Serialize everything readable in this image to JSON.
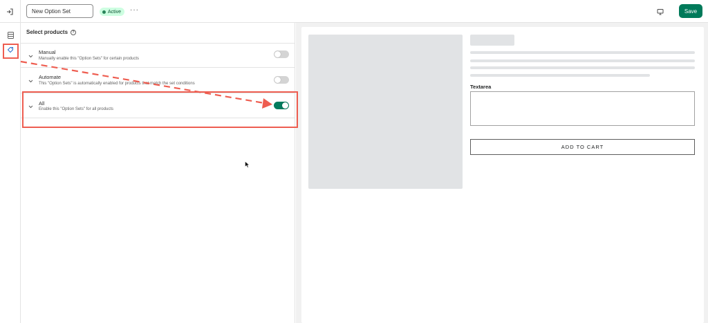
{
  "topbar": {
    "name_value": "New Option Set",
    "status": "Active",
    "more_label": "···",
    "save_label": "Save"
  },
  "panel": {
    "title": "Select products",
    "options": [
      {
        "title": "Manual",
        "description": "Manually enable this \"Option Sets\" for certain products",
        "enabled": false
      },
      {
        "title": "Automate",
        "description": "This \"Option Sets\" is automatically enabled for products that match the set conditions",
        "enabled": false
      },
      {
        "title": "All",
        "description": "Enable this \"Option Sets\" for all products",
        "enabled": true
      }
    ]
  },
  "preview": {
    "textarea_label": "Textarea",
    "add_to_cart_label": "ADD TO CART"
  },
  "colors": {
    "accent": "#007a5a",
    "annotation": "#ee5d50",
    "badge_bg": "#cdfee1"
  }
}
